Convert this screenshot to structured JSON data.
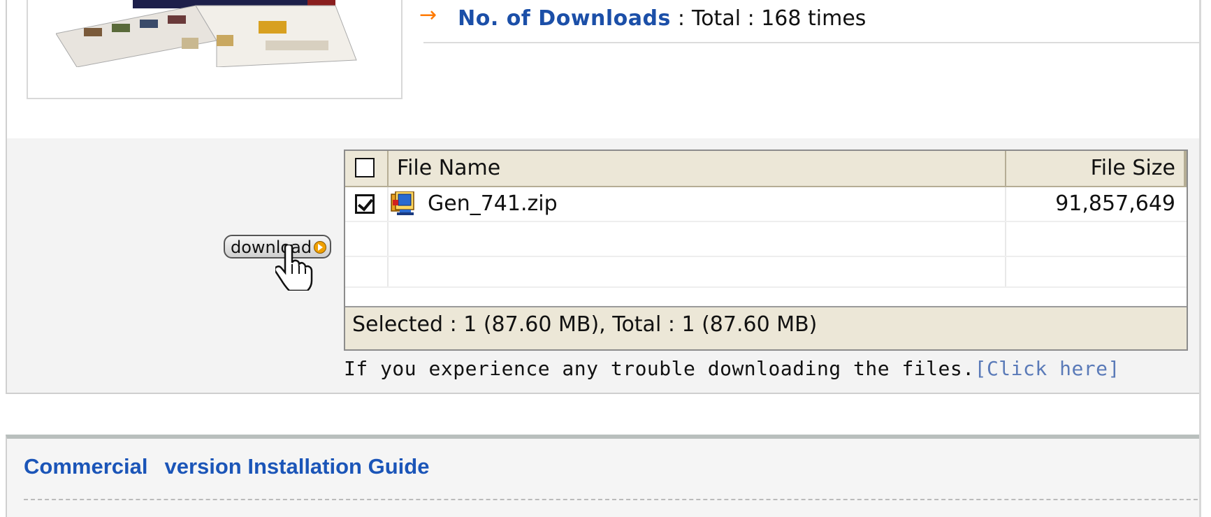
{
  "downloads": {
    "arrow": "→",
    "label": "No. of Downloads",
    "separator": ":",
    "value": "Total : 168 times"
  },
  "download_button": {
    "label": "download"
  },
  "file_table": {
    "header_file_name": "File Name",
    "header_file_size": "File Size",
    "header_checkbox_checked": false,
    "rows": [
      {
        "checked": true,
        "icon": "zip-archive-icon",
        "name": "Gen_741.zip",
        "size": "91,857,649"
      }
    ],
    "footer": "Selected : 1 (87.60 MB), Total : 1 (87.60 MB)"
  },
  "trouble": {
    "text": "If you experience any trouble downloading the files.",
    "link": "[Click here]"
  },
  "guide": {
    "title_strong": "Commercial",
    "title_rest": "version Installation Guide"
  },
  "colors": {
    "link_blue": "#1b4fa8",
    "arrow_orange": "#ff7a00",
    "table_header_bg": "#ece7d7",
    "section_bg": "#f3f3f3"
  }
}
